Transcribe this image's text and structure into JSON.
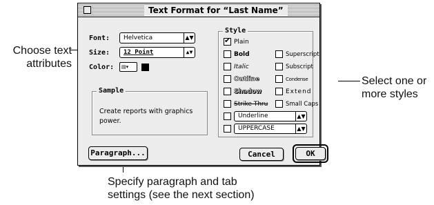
{
  "callouts": {
    "left": [
      "Choose text",
      "attributes"
    ],
    "right": [
      "Select one or",
      "more styles"
    ],
    "bottom": [
      "Specify paragraph and tab",
      "settings (see the next section)"
    ]
  },
  "dialog": {
    "title": "Text Format for “Last Name”",
    "font": {
      "label": "Font:",
      "value": "Helvetica"
    },
    "size": {
      "label": "Size:",
      "value": "12 Point"
    },
    "color": {
      "label": "Color:",
      "swatch": "#000000"
    },
    "sample": {
      "title": "Sample",
      "text": "Create reports with graphics power."
    },
    "style": {
      "title": "Style",
      "left": [
        {
          "label": "Plain",
          "checked": true
        },
        {
          "label": "Bold",
          "checked": false
        },
        {
          "label": "Italic",
          "checked": false
        },
        {
          "label": "Outline",
          "checked": false
        },
        {
          "label": "Shadow",
          "checked": false
        },
        {
          "label": "Strike Thru",
          "checked": false
        }
      ],
      "right": [
        {
          "label": "Superscript",
          "checked": false
        },
        {
          "label": "Subscript",
          "checked": false
        },
        {
          "label": "Condense",
          "checked": false
        },
        {
          "label": "Extend",
          "checked": false
        },
        {
          "label": "Small Caps",
          "checked": false
        }
      ],
      "underline_popup": "Underline",
      "case_popup": "UPPERCASE"
    },
    "buttons": {
      "paragraph": "Paragraph...",
      "cancel": "Cancel",
      "ok": "OK"
    }
  }
}
